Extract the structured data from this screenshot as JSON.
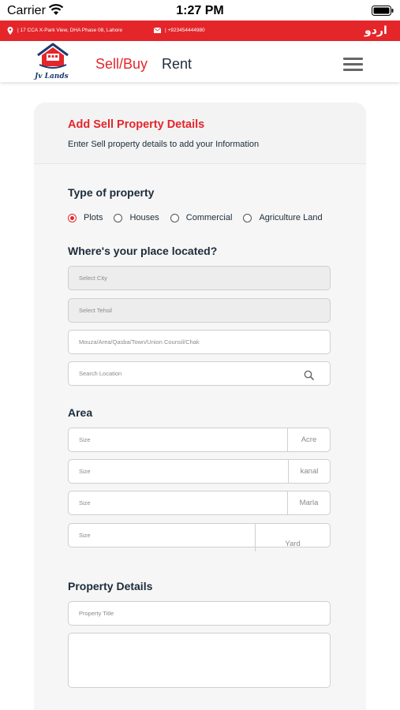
{
  "status_bar": {
    "carrier": "Carrier",
    "time": "1:27 PM"
  },
  "top_bar": {
    "address": "|  17 CCA X-Park View, DHA Phase 08, Lahore",
    "phone": "|  +923454444980",
    "language": "اردو",
    "background_color": "#e4262b"
  },
  "header": {
    "logo_text": "Jv Lands",
    "nav": {
      "sell_buy": "Sell/Buy",
      "rent": "Rent"
    },
    "accent_color": "#e4262b"
  },
  "form": {
    "title": "Add Sell Property Details",
    "subtitle": "Enter Sell property details to add your Information",
    "type_section": {
      "title": "Type of property",
      "options": [
        "Plots",
        "Houses",
        "Commercial",
        "Agriculture Land"
      ],
      "selected": "Plots"
    },
    "location_section": {
      "title": "Where's your place located?",
      "city_placeholder": "Select City",
      "tehsil_placeholder": "Select Tehsil",
      "mouza_placeholder": "Mouza/Area/Qasba/Town/Union Counsil/Chak",
      "search_placeholder": "Search Location"
    },
    "area_section": {
      "title": "Area",
      "fields": [
        {
          "placeholder": "Size",
          "unit": "Acre"
        },
        {
          "placeholder": "Size",
          "unit": "kanal"
        },
        {
          "placeholder": "Size",
          "unit": "Marla"
        },
        {
          "placeholder": "Size",
          "unit": "Yard"
        }
      ]
    },
    "details_section": {
      "title": "Property Details",
      "title_placeholder": "Property Title"
    }
  }
}
